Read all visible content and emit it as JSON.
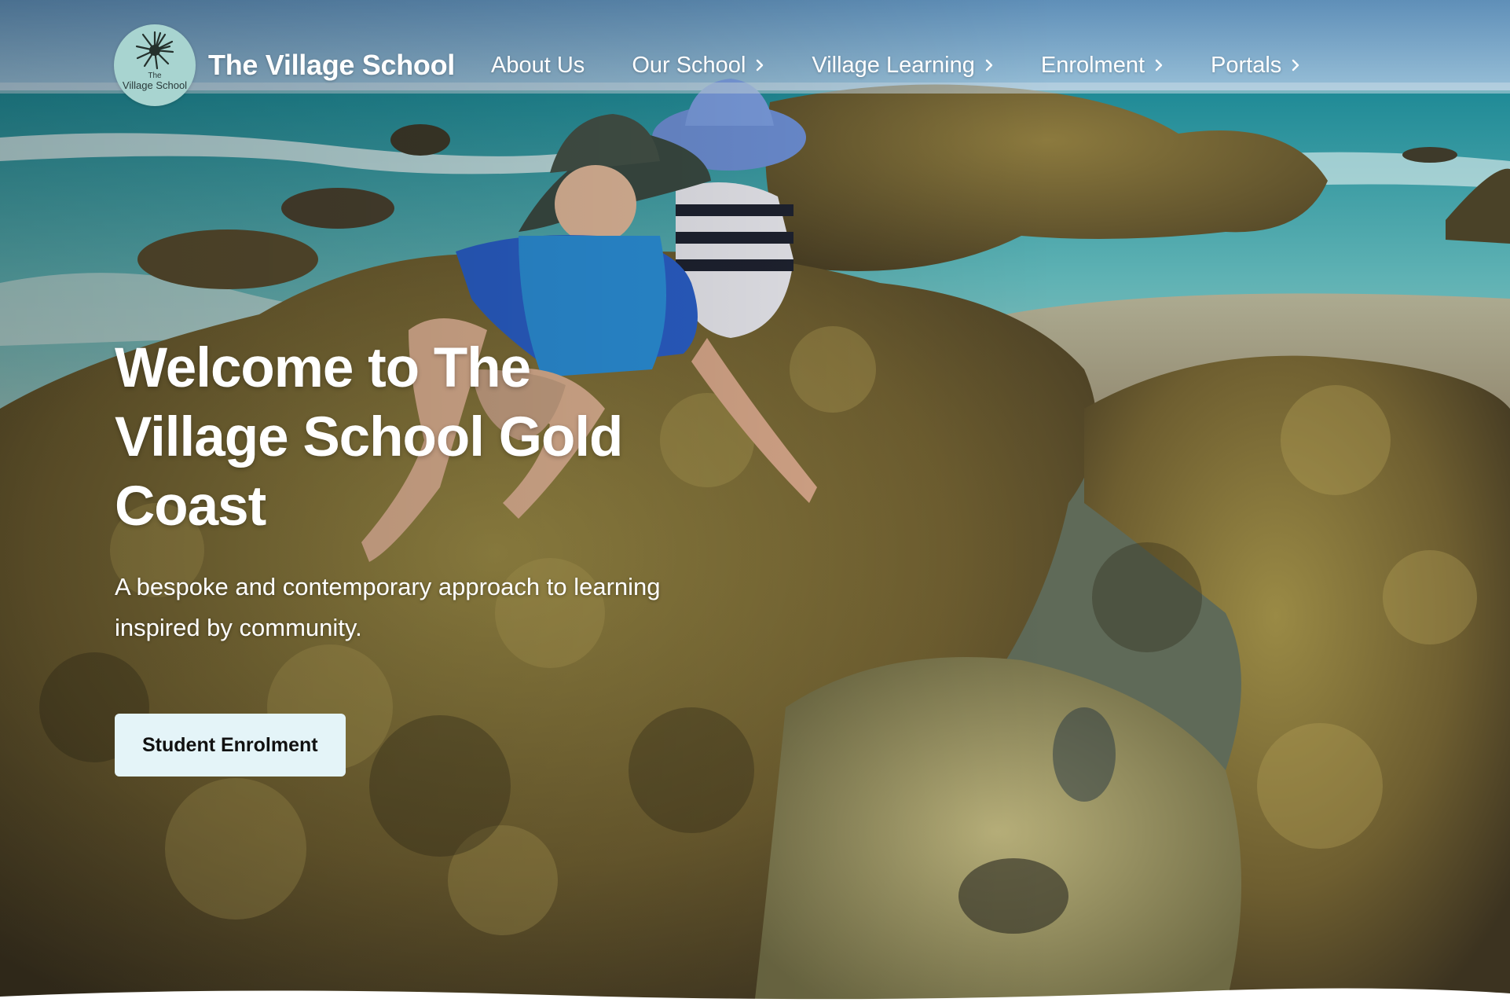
{
  "brand": {
    "logo_text_line1": "The",
    "logo_text_line2": "Village School",
    "logo_icon": "sun-burst-icon",
    "name": "The Village School"
  },
  "nav": {
    "items": [
      {
        "label": "About Us",
        "has_submenu": false
      },
      {
        "label": "Our School",
        "has_submenu": true
      },
      {
        "label": "Village Learning",
        "has_submenu": true
      },
      {
        "label": "Enrolment",
        "has_submenu": true
      },
      {
        "label": "Portals",
        "has_submenu": true
      }
    ],
    "chevron_icon": "chevron-right-icon"
  },
  "hero": {
    "headline": "Welcome to The Village School Gold Coast",
    "subhead": "A bespoke and contemporary approach to learning inspired by community.",
    "cta_label": "Student Enrolment"
  },
  "colors": {
    "cta_background": "#e4f4f8",
    "logo_background": "#a8d4d0",
    "text": "#ffffff"
  }
}
